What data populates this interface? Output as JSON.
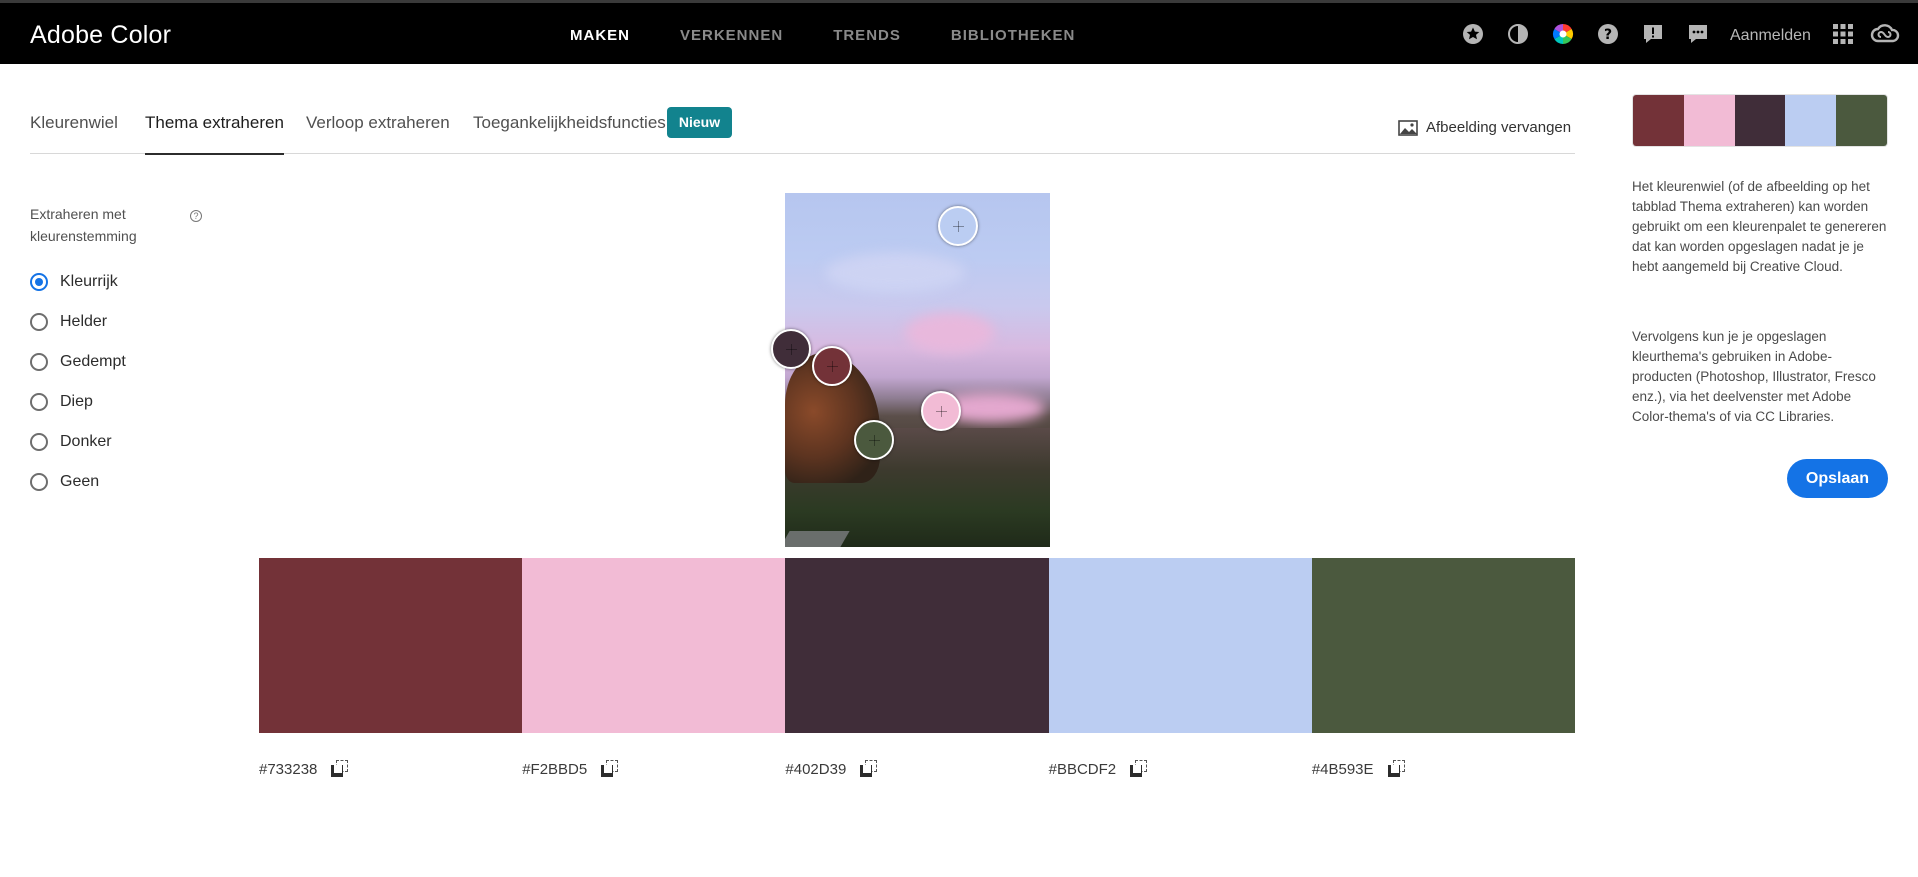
{
  "app": {
    "title": "Adobe Color"
  },
  "nav": {
    "items": [
      "MAKEN",
      "VERKENNEN",
      "TRENDS",
      "BIBLIOTHEKEN"
    ],
    "active": "MAKEN"
  },
  "toolbar": {
    "icons": [
      "star-icon",
      "contrast-icon",
      "color-wheel-icon",
      "help-icon",
      "feedback-icon",
      "comments-icon",
      "apps-grid-icon",
      "creative-cloud-icon"
    ],
    "signin_label": "Aanmelden"
  },
  "tabs": {
    "items": [
      "Kleurenwiel",
      "Thema extraheren",
      "Verloop extraheren",
      "Toegankelijkheidsfuncties"
    ],
    "active": "Thema extraheren",
    "new_badge": "Nieuw",
    "replace_image_label": "Afbeelding vervangen"
  },
  "mood": {
    "title": "Extraheren met kleurenstemming",
    "help_glyph": "?",
    "options": [
      "Kleurrijk",
      "Helder",
      "Gedempt",
      "Diep",
      "Donker",
      "Geen"
    ],
    "selected": "Kleurrijk"
  },
  "theme": {
    "colors": [
      "#733238",
      "#F2BBD5",
      "#402D39",
      "#BBCDF2",
      "#4B593E"
    ],
    "hex_labels": [
      "#733238",
      "#F2BBD5",
      "#402D39",
      "#BBCDF2",
      "#4B593E"
    ]
  },
  "info": {
    "paragraph1": "Het kleurenwiel (of de afbeelding op het tabblad Thema extraheren) kan worden gebruikt om een kleurenpalet te genereren dat kan worden opgeslagen nadat je je hebt aangemeld bij Creative Cloud.",
    "paragraph2": "Vervolgens kun je je opgeslagen kleurthema's gebruiken in Adobe-producten (Photoshop, Illustrator, Fresco enz.), via het deelvenster met Adobe Color-thema's of via CC Libraries.",
    "save_label": "Opslaan"
  }
}
